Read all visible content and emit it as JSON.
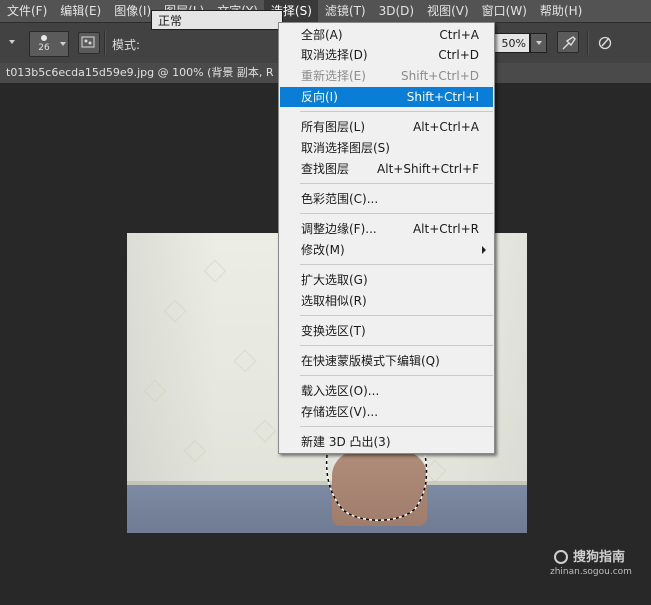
{
  "menubar": {
    "items": [
      "文件(F)",
      "编辑(E)",
      "图像(I)",
      "图层(L)",
      "文字(Y)",
      "选择(S)",
      "滤镜(T)",
      "3D(D)",
      "视图(V)",
      "窗口(W)",
      "帮助(H)"
    ],
    "active_index": 5
  },
  "options": {
    "brush_size": "26",
    "mode_label": "模式:",
    "mode_value": "正常",
    "opacity_value": "50%",
    "icons": [
      "chevron-down-icon",
      "brush-preset-icon",
      "brush-panel-icon",
      "airbrush-icon",
      "pressure-icon"
    ]
  },
  "document": {
    "tab_title": "t013b5c6ecda15d59e9.jpg @ 100% (背景 副本, R"
  },
  "select_menu": {
    "items": [
      {
        "label": "全部(A)",
        "shortcut": "Ctrl+A",
        "state": "normal"
      },
      {
        "label": "取消选择(D)",
        "shortcut": "Ctrl+D",
        "state": "normal"
      },
      {
        "label": "重新选择(E)",
        "shortcut": "Shift+Ctrl+D",
        "state": "disabled"
      },
      {
        "label": "反向(I)",
        "shortcut": "Shift+Ctrl+I",
        "state": "highlighted"
      },
      {
        "label": "所有图层(L)",
        "shortcut": "Alt+Ctrl+A",
        "state": "normal"
      },
      {
        "label": "取消选择图层(S)",
        "shortcut": "",
        "state": "normal"
      },
      {
        "label": "查找图层",
        "shortcut": "Alt+Shift+Ctrl+F",
        "state": "normal"
      },
      {
        "label": "色彩范围(C)...",
        "shortcut": "",
        "state": "normal"
      },
      {
        "label": "调整边缘(F)...",
        "shortcut": "Alt+Ctrl+R",
        "state": "normal"
      },
      {
        "label": "修改(M)",
        "shortcut": "",
        "state": "submenu"
      },
      {
        "label": "扩大选取(G)",
        "shortcut": "",
        "state": "normal"
      },
      {
        "label": "选取相似(R)",
        "shortcut": "",
        "state": "normal"
      },
      {
        "label": "变换选区(T)",
        "shortcut": "",
        "state": "normal"
      },
      {
        "label": "在快速蒙版模式下编辑(Q)",
        "shortcut": "",
        "state": "normal"
      },
      {
        "label": "载入选区(O)...",
        "shortcut": "",
        "state": "normal"
      },
      {
        "label": "存储选区(V)...",
        "shortcut": "",
        "state": "normal"
      },
      {
        "label": "新建 3D 凸出(3)",
        "shortcut": "",
        "state": "normal"
      }
    ]
  },
  "watermark": {
    "main": "搜狗指南",
    "sub": "zhinan.sogou.com"
  },
  "colors": {
    "menubar_bg": "#535353",
    "options_bg": "#424242",
    "canvas_bg": "#282828",
    "menu_bg": "#f0f0f0",
    "highlight": "#0a7ed6"
  }
}
